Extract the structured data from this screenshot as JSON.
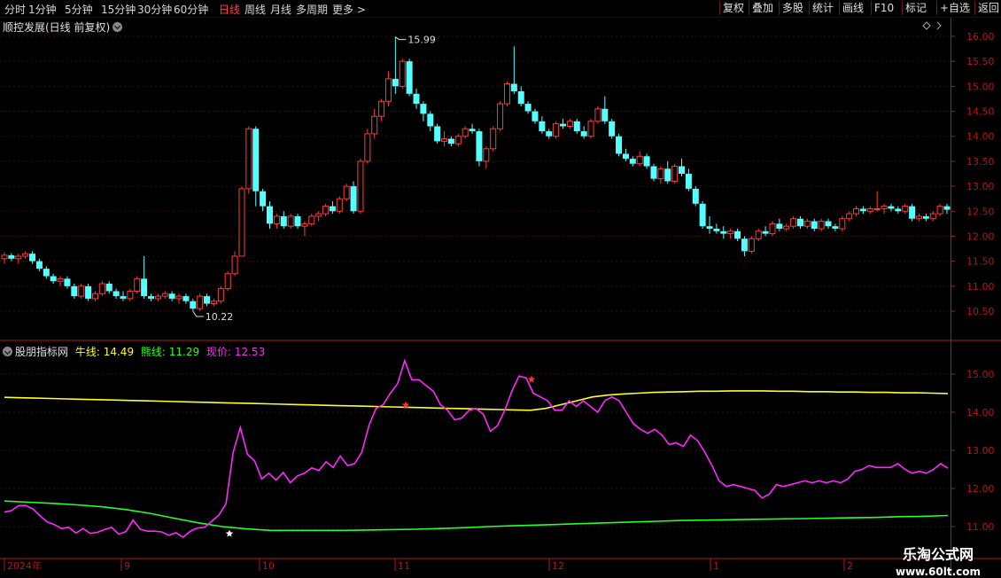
{
  "toolbar": {
    "periods": [
      "分时",
      "1分钟",
      "5分钟",
      "15分钟",
      "30分钟",
      "60分钟",
      "日线",
      "周线",
      "月线",
      "多周期",
      "更多 >"
    ],
    "active_period": "日线",
    "buttons": [
      "复权",
      "叠加",
      "多股",
      "统计",
      "画线",
      "F10",
      "标记",
      "+自选",
      "返回"
    ]
  },
  "main_panel": {
    "title": "顺控发展(日线 前复权)",
    "price_axis": [
      "16.00",
      "15.50",
      "15.00",
      "14.50",
      "14.00",
      "13.50",
      "13.00",
      "12.50",
      "12.00",
      "11.50",
      "11.00",
      "10.50"
    ],
    "high_marker": "15.99",
    "low_marker": "10.22"
  },
  "indicator_panel": {
    "name": "股朋指标网",
    "bull_label": "牛线:",
    "bull_value": "14.49",
    "bear_label": "熊线:",
    "bear_value": "11.29",
    "price_label": "现价:",
    "price_value": "12.53",
    "axis": [
      "15.00",
      "14.00",
      "13.00",
      "12.00",
      "11.00"
    ]
  },
  "time_axis": [
    "2024年",
    "9",
    "10",
    "11",
    "12",
    "1",
    "2"
  ],
  "watermark": {
    "name": "乐淘公式网",
    "url": "www.60lt.com"
  },
  "colors": {
    "up": "#ff3c3c",
    "down": "#54ffff",
    "bull_line": "#ffff28",
    "bear_line": "#28ff28",
    "price_line": "#ff28ff",
    "axis_red": "#b01818"
  },
  "chart_data": [
    {
      "type": "candlestick",
      "title": "顺控发展(日线 前复权)",
      "ylim": [
        10.2,
        16.2
      ],
      "annotations": [
        {
          "label": "15.99",
          "value": 15.99
        },
        {
          "label": "10.22",
          "value": 10.22
        }
      ],
      "candles": [
        [
          11.55,
          11.68,
          11.45,
          11.62
        ],
        [
          11.62,
          11.66,
          11.5,
          11.55
        ],
        [
          11.55,
          11.65,
          11.45,
          11.6
        ],
        [
          11.6,
          11.7,
          11.55,
          11.65
        ],
        [
          11.65,
          11.7,
          11.45,
          11.5
        ],
        [
          11.5,
          11.55,
          11.3,
          11.35
        ],
        [
          11.35,
          11.4,
          11.15,
          11.2
        ],
        [
          11.2,
          11.25,
          11.05,
          11.1
        ],
        [
          11.1,
          11.2,
          11.0,
          11.15
        ],
        [
          11.15,
          11.2,
          10.95,
          11.0
        ],
        [
          11.0,
          11.05,
          10.75,
          10.8
        ],
        [
          10.8,
          11.05,
          10.75,
          11.0
        ],
        [
          11.0,
          11.05,
          10.7,
          10.75
        ],
        [
          10.75,
          10.9,
          10.7,
          10.85
        ],
        [
          10.85,
          11.1,
          10.8,
          11.05
        ],
        [
          11.05,
          11.1,
          10.85,
          10.9
        ],
        [
          10.9,
          10.95,
          10.75,
          10.8
        ],
        [
          10.8,
          10.9,
          10.7,
          10.75
        ],
        [
          10.75,
          10.95,
          10.7,
          10.9
        ],
        [
          10.9,
          11.2,
          10.85,
          11.15
        ],
        [
          11.15,
          11.6,
          10.75,
          10.8
        ],
        [
          10.8,
          10.85,
          10.7,
          10.75
        ],
        [
          10.75,
          10.85,
          10.7,
          10.8
        ],
        [
          10.8,
          10.9,
          10.75,
          10.85
        ],
        [
          10.85,
          10.9,
          10.7,
          10.75
        ],
        [
          10.75,
          10.85,
          10.65,
          10.8
        ],
        [
          10.8,
          10.85,
          10.65,
          10.7
        ],
        [
          10.7,
          10.75,
          10.5,
          10.55
        ],
        [
          10.55,
          10.85,
          10.5,
          10.8
        ],
        [
          10.8,
          10.85,
          10.6,
          10.65
        ],
        [
          10.65,
          10.75,
          10.6,
          10.7
        ],
        [
          10.7,
          11.0,
          10.65,
          10.95
        ],
        [
          10.95,
          11.3,
          10.9,
          11.25
        ],
        [
          11.25,
          11.7,
          11.2,
          11.6
        ],
        [
          11.6,
          13.0,
          11.95,
          12.95
        ],
        [
          12.95,
          14.2,
          12.85,
          14.15
        ],
        [
          14.15,
          14.2,
          12.6,
          12.9
        ],
        [
          12.9,
          12.95,
          12.5,
          12.6
        ],
        [
          12.6,
          12.7,
          12.15,
          12.25
        ],
        [
          12.25,
          12.45,
          12.15,
          12.4
        ],
        [
          12.4,
          12.5,
          12.15,
          12.2
        ],
        [
          12.2,
          12.45,
          12.15,
          12.4
        ],
        [
          12.4,
          12.45,
          12.15,
          12.2
        ],
        [
          12.2,
          12.3,
          12.0,
          12.25
        ],
        [
          12.25,
          12.45,
          12.2,
          12.4
        ],
        [
          12.4,
          12.5,
          12.3,
          12.45
        ],
        [
          12.45,
          12.65,
          12.4,
          12.6
        ],
        [
          12.6,
          12.7,
          12.45,
          12.5
        ],
        [
          12.5,
          12.8,
          12.45,
          12.75
        ],
        [
          12.75,
          13.05,
          12.7,
          13.0
        ],
        [
          13.0,
          13.1,
          12.45,
          12.5
        ],
        [
          12.5,
          13.55,
          12.45,
          13.5
        ],
        [
          13.5,
          14.15,
          13.45,
          14.05
        ],
        [
          14.05,
          14.55,
          13.95,
          14.4
        ],
        [
          14.4,
          14.75,
          14.3,
          14.7
        ],
        [
          14.7,
          15.3,
          14.6,
          15.15
        ],
        [
          15.15,
          15.99,
          14.85,
          15.0
        ],
        [
          15.0,
          15.55,
          14.95,
          15.5
        ],
        [
          15.5,
          15.55,
          14.8,
          14.85
        ],
        [
          14.85,
          14.95,
          14.55,
          14.65
        ],
        [
          14.65,
          14.7,
          14.3,
          14.45
        ],
        [
          14.45,
          14.5,
          14.1,
          14.2
        ],
        [
          14.2,
          14.25,
          13.85,
          13.9
        ],
        [
          13.9,
          14.1,
          13.8,
          13.95
        ],
        [
          13.95,
          14.0,
          13.8,
          13.85
        ],
        [
          13.85,
          14.05,
          13.8,
          14.0
        ],
        [
          14.0,
          14.2,
          13.95,
          14.15
        ],
        [
          14.15,
          14.25,
          14.05,
          14.1
        ],
        [
          14.1,
          14.15,
          13.4,
          13.5
        ],
        [
          13.5,
          13.8,
          13.35,
          13.75
        ],
        [
          13.75,
          14.2,
          13.7,
          14.15
        ],
        [
          14.15,
          14.7,
          14.1,
          14.65
        ],
        [
          14.65,
          15.1,
          14.6,
          15.05
        ],
        [
          15.05,
          15.8,
          14.85,
          14.9
        ],
        [
          14.9,
          15.0,
          14.6,
          14.65
        ],
        [
          14.65,
          14.7,
          14.45,
          14.5
        ],
        [
          14.5,
          14.55,
          14.25,
          14.3
        ],
        [
          14.3,
          14.4,
          14.05,
          14.1
        ],
        [
          14.1,
          14.15,
          13.95,
          14.0
        ],
        [
          14.0,
          14.3,
          13.95,
          14.25
        ],
        [
          14.25,
          14.35,
          14.15,
          14.2
        ],
        [
          14.2,
          14.35,
          14.15,
          14.3
        ],
        [
          14.3,
          14.35,
          14.05,
          14.1
        ],
        [
          14.1,
          14.2,
          13.95,
          14.0
        ],
        [
          14.0,
          14.35,
          13.95,
          14.3
        ],
        [
          14.3,
          14.6,
          14.25,
          14.55
        ],
        [
          14.55,
          14.8,
          14.25,
          14.3
        ],
        [
          14.3,
          14.35,
          13.95,
          14.0
        ],
        [
          14.0,
          14.05,
          13.6,
          13.65
        ],
        [
          13.65,
          13.75,
          13.5,
          13.55
        ],
        [
          13.55,
          13.6,
          13.4,
          13.45
        ],
        [
          13.45,
          13.7,
          13.4,
          13.6
        ],
        [
          13.6,
          13.65,
          13.35,
          13.4
        ],
        [
          13.4,
          13.45,
          13.1,
          13.15
        ],
        [
          13.15,
          13.4,
          13.05,
          13.35
        ],
        [
          13.35,
          13.5,
          13.05,
          13.1
        ],
        [
          13.1,
          13.45,
          13.05,
          13.4
        ],
        [
          13.4,
          13.55,
          13.2,
          13.25
        ],
        [
          13.25,
          13.35,
          12.9,
          12.95
        ],
        [
          12.95,
          13.0,
          12.6,
          12.65
        ],
        [
          12.65,
          12.7,
          12.15,
          12.2
        ],
        [
          12.2,
          12.4,
          12.05,
          12.15
        ],
        [
          12.15,
          12.25,
          12.05,
          12.1
        ],
        [
          12.1,
          12.2,
          11.95,
          12.05
        ],
        [
          12.05,
          12.15,
          11.95,
          12.1
        ],
        [
          12.1,
          12.15,
          11.9,
          11.95
        ],
        [
          11.95,
          12.0,
          11.6,
          11.7
        ],
        [
          11.7,
          12.0,
          11.65,
          11.95
        ],
        [
          11.95,
          12.15,
          11.9,
          12.1
        ],
        [
          12.1,
          12.2,
          12.0,
          12.05
        ],
        [
          12.05,
          12.3,
          12.0,
          12.25
        ],
        [
          12.25,
          12.35,
          12.1,
          12.15
        ],
        [
          12.15,
          12.25,
          12.1,
          12.2
        ],
        [
          12.2,
          12.4,
          12.15,
          12.35
        ],
        [
          12.35,
          12.4,
          12.15,
          12.2
        ],
        [
          12.2,
          12.35,
          12.15,
          12.3
        ],
        [
          12.3,
          12.35,
          12.1,
          12.15
        ],
        [
          12.15,
          12.35,
          12.1,
          12.3
        ],
        [
          12.3,
          12.35,
          12.15,
          12.2
        ],
        [
          12.2,
          12.25,
          12.1,
          12.15
        ],
        [
          12.15,
          12.4,
          12.1,
          12.35
        ],
        [
          12.35,
          12.5,
          12.3,
          12.45
        ],
        [
          12.45,
          12.6,
          12.4,
          12.55
        ],
        [
          12.55,
          12.6,
          12.45,
          12.5
        ],
        [
          12.5,
          12.6,
          12.45,
          12.55
        ],
        [
          12.55,
          12.9,
          12.5,
          12.55
        ],
        [
          12.55,
          12.65,
          12.45,
          12.6
        ],
        [
          12.6,
          12.65,
          12.5,
          12.55
        ],
        [
          12.55,
          12.6,
          12.45,
          12.5
        ],
        [
          12.5,
          12.65,
          12.45,
          12.6
        ],
        [
          12.6,
          12.65,
          12.3,
          12.35
        ],
        [
          12.35,
          12.45,
          12.3,
          12.4
        ],
        [
          12.4,
          12.45,
          12.3,
          12.35
        ],
        [
          12.35,
          12.5,
          12.3,
          12.45
        ],
        [
          12.45,
          12.65,
          12.4,
          12.6
        ],
        [
          12.6,
          12.65,
          12.45,
          12.53
        ]
      ]
    },
    {
      "type": "line",
      "title": "股朋指标网",
      "ylim": [
        10.6,
        15.7
      ],
      "series": [
        {
          "name": "牛线",
          "values": [
            14.39,
            14.38,
            14.37,
            14.36,
            14.35,
            14.34,
            14.33,
            14.32,
            14.31,
            14.3,
            14.29,
            14.28,
            14.27,
            14.26,
            14.25,
            14.24,
            14.23,
            14.22,
            14.21,
            14.2,
            14.19,
            14.18,
            14.17,
            14.16,
            14.15,
            14.14,
            14.13,
            14.12,
            14.11,
            14.1,
            14.09,
            14.08,
            14.07,
            14.06,
            14.05,
            14.1,
            14.2,
            14.3,
            14.4,
            14.45,
            14.48,
            14.5,
            14.52,
            14.53,
            14.54,
            14.55,
            14.55,
            14.56,
            14.56,
            14.56,
            14.55,
            14.55,
            14.54,
            14.54,
            14.53,
            14.53,
            14.52,
            14.52,
            14.51,
            14.51,
            14.5,
            14.49
          ]
        },
        {
          "name": "熊线",
          "values": [
            11.67,
            11.64,
            11.61,
            11.57,
            11.52,
            11.45,
            11.35,
            11.22,
            11.1,
            11.0,
            10.94,
            10.9,
            10.9,
            10.9,
            10.9,
            10.91,
            10.92,
            10.93,
            10.95,
            10.97,
            11.0,
            11.02,
            11.04,
            11.06,
            11.08,
            11.1,
            11.12,
            11.14,
            11.16,
            11.17,
            11.18,
            11.19,
            11.2,
            11.21,
            11.22,
            11.23,
            11.24,
            11.26,
            11.27,
            11.29
          ]
        },
        {
          "name": "现价",
          "values": [
            11.38,
            11.42,
            11.55,
            11.55,
            11.46,
            11.28,
            11.12,
            11.05,
            10.95,
            10.98,
            10.83,
            10.95,
            10.82,
            10.85,
            10.92,
            10.98,
            10.8,
            10.87,
            11.17,
            10.93,
            10.88,
            10.88,
            10.86,
            10.77,
            10.84,
            10.72,
            10.88,
            10.96,
            10.98,
            11.14,
            11.3,
            11.6,
            12.95,
            13.6,
            12.9,
            12.72,
            12.25,
            12.4,
            12.22,
            12.42,
            12.15,
            12.33,
            12.4,
            12.54,
            12.47,
            12.7,
            12.55,
            12.85,
            12.6,
            12.65,
            12.95,
            13.65,
            14.1,
            14.2,
            14.5,
            14.75,
            15.35,
            14.85,
            14.85,
            14.7,
            14.55,
            14.2,
            14.05,
            13.8,
            13.85,
            14.05,
            14.1,
            13.95,
            13.5,
            13.65,
            14.05,
            14.55,
            14.95,
            14.9,
            14.5,
            14.4,
            14.3,
            14.05,
            14.05,
            14.3,
            14.15,
            14.3,
            14.15,
            14.0,
            14.3,
            14.4,
            14.3,
            14.0,
            13.7,
            13.55,
            13.45,
            13.55,
            13.4,
            13.15,
            13.2,
            13.1,
            13.4,
            13.25,
            12.95,
            12.6,
            12.2,
            12.05,
            12.1,
            12.05,
            12.0,
            11.95,
            11.75,
            11.85,
            12.1,
            12.05,
            12.1,
            12.15,
            12.2,
            12.15,
            12.2,
            12.15,
            12.2,
            12.15,
            12.25,
            12.45,
            12.5,
            12.6,
            12.55,
            12.55,
            12.55,
            12.65,
            12.5,
            12.4,
            12.45,
            12.4,
            12.5,
            12.65,
            12.53
          ]
        }
      ],
      "signals": [
        {
          "type": "star",
          "color": "white"
        },
        {
          "type": "star",
          "color": "red"
        },
        {
          "type": "star",
          "color": "red"
        }
      ]
    }
  ]
}
